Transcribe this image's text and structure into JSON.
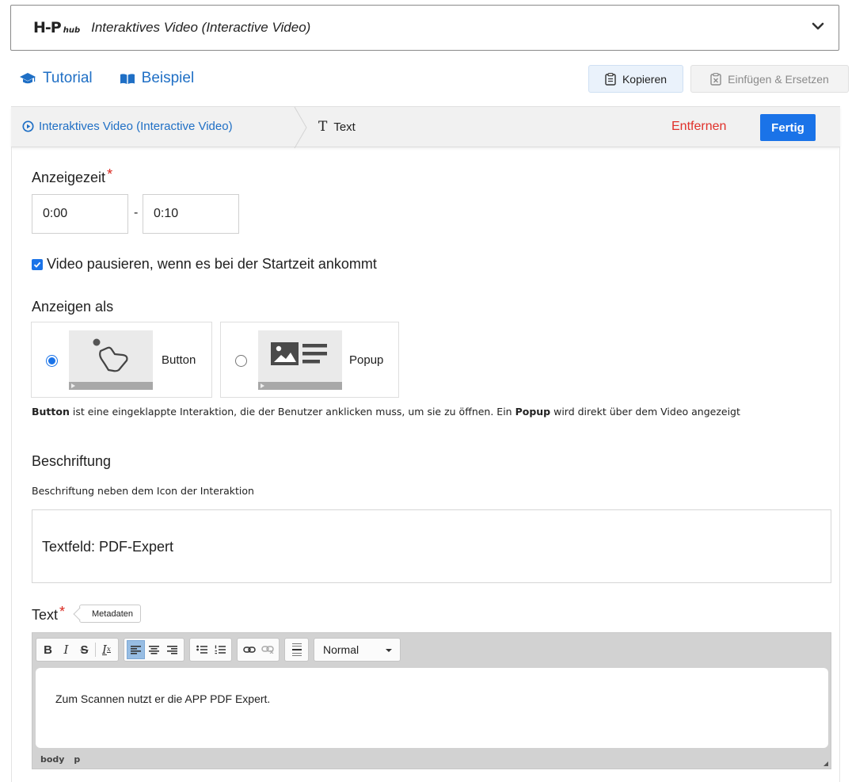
{
  "hub": {
    "logo_main": "H-P",
    "logo_sub": "hub",
    "title": "Interaktives Video (Interactive Video)"
  },
  "links": {
    "tutorial": "Tutorial",
    "example": "Beispiel"
  },
  "clipboard": {
    "copy_label": "Kopieren",
    "paste_label": "Einfügen & Ersetzen"
  },
  "breadcrumb": {
    "parent": "Interaktives Video (Interactive Video)",
    "current": "Text",
    "remove_label": "Entfernen",
    "done_label": "Fertig"
  },
  "display_time": {
    "label": "Anzeigezeit",
    "required_mark": "*",
    "start": "0:00",
    "separator": "-",
    "end": "0:10"
  },
  "pause_option": {
    "checked": true,
    "label": "Video pausieren, wenn es bei der Startzeit ankommt"
  },
  "display_as": {
    "label": "Anzeigen als",
    "options": [
      {
        "label": "Button",
        "selected": true
      },
      {
        "label": "Popup",
        "selected": false
      }
    ],
    "help_bold_1": "Button",
    "help_text_1": " ist eine eingeklappte Interaktion, die der Benutzer anklicken muss, um sie zu öffnen. Ein ",
    "help_bold_2": "Popup",
    "help_text_2": " wird direkt über dem Video angezeigt"
  },
  "caption": {
    "label": "Beschriftung",
    "description": "Beschriftung neben dem Icon der Interaktion",
    "value": "Textfeld: PDF-Expert"
  },
  "text_field": {
    "label": "Text",
    "required_mark": "*",
    "metadata_label": "Metadaten",
    "format_value": "Normal",
    "content": "Zum Scannen nutzt er die APP PDF Expert.",
    "path": [
      "body",
      "p"
    ]
  },
  "colors": {
    "accent": "#1a73e8",
    "link": "#1f6fc5",
    "danger": "#e0302a"
  }
}
